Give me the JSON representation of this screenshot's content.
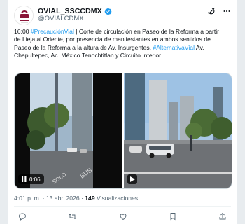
{
  "author": {
    "name": "OVIAL_SSCCDMX",
    "handle": "@OVIALCDMX",
    "avatar_icon": "ovial-logo-icon",
    "verified_icon": "verified-badge-icon"
  },
  "header_icons": [
    "grok-icon",
    "more-options-icon"
  ],
  "tweet": {
    "time_prefix": "16:00 ",
    "hashtag_1": "#PrecauciónVial",
    "body_1": " | Corte de circulación en Paseo de la Reforma a partir de Lieja al Oriente, por presencia de manifestantes en ambos sentidos de Paseo de la Reforma a la altura de Av. Insurgentes.",
    "hashtag_2": "#AlternativaVial",
    "body_2": " Av. Chapultepec, Ac. México Tenochtitlan y Circuito Interior."
  },
  "media": {
    "video_time": "0:06",
    "pause_icon": "pause-icon",
    "video_icon": "play-icon"
  },
  "meta": {
    "time": "4:01 p. m. · 13 abr. 2026 · ",
    "views_count": "149",
    "views_label": " Visualizaciones"
  },
  "actions": [
    "reply-icon",
    "retweet-icon",
    "like-icon",
    "bookmark-icon",
    "share-icon"
  ],
  "colors": {
    "link": "#1d9bf0",
    "verified": "#1d9bf0",
    "muted": "#536471"
  }
}
